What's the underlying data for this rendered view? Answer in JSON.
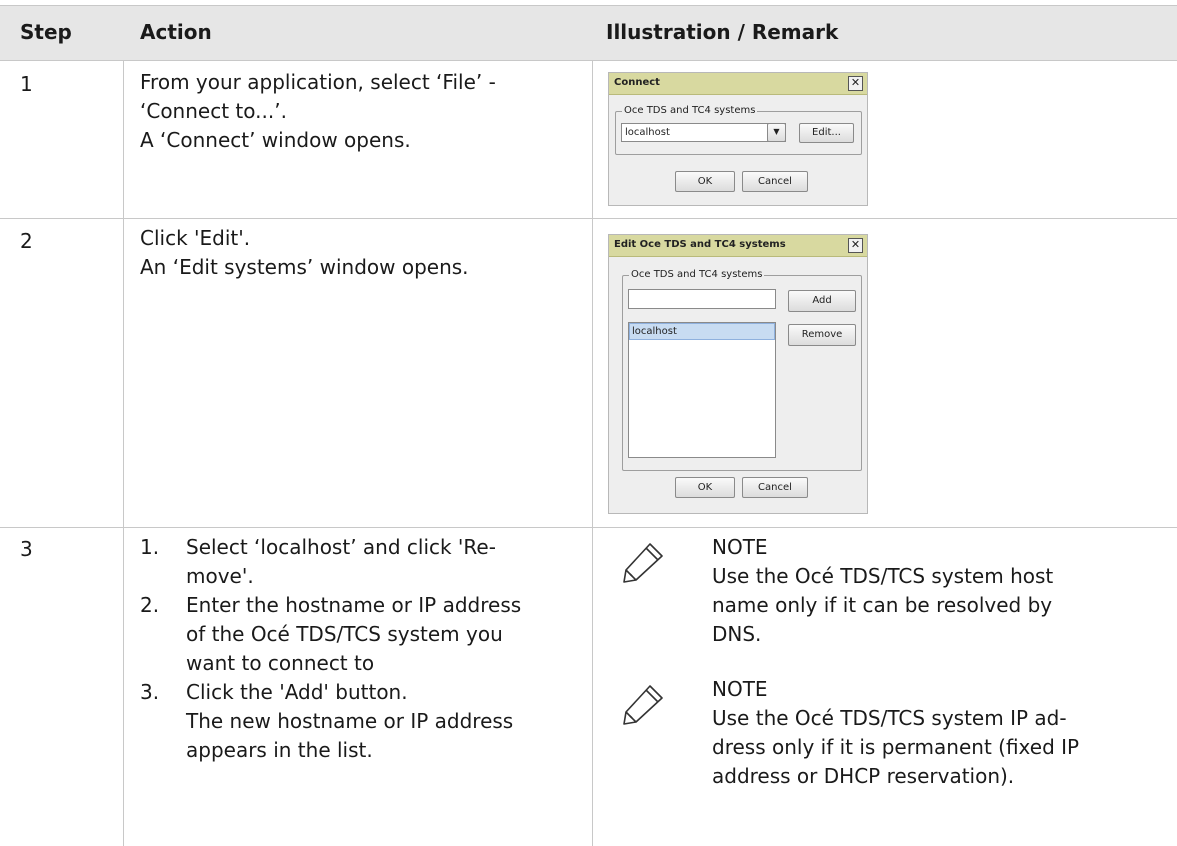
{
  "headers": {
    "step": "Step",
    "action": "Action",
    "illustration": "Illustration / Remark"
  },
  "rows": [
    {
      "step": "1",
      "action_lines": [
        "From your application, select ‘File’ -",
        "‘Connect to...’.",
        "A ‘Connect’ window opens."
      ]
    },
    {
      "step": "2",
      "action_lines": [
        "Click 'Edit'.",
        "An ‘Edit systems’ window opens."
      ]
    },
    {
      "step": "3",
      "list": [
        {
          "num": "1.",
          "lines": [
            "Select ‘localhost’ and click 'Re-",
            "move'."
          ]
        },
        {
          "num": "2.",
          "lines": [
            "Enter the hostname or IP address",
            "of the Océ TDS/TCS system you",
            "want to connect to"
          ]
        },
        {
          "num": "3.",
          "lines": [
            "Click the 'Add' button.",
            "The new hostname or IP address",
            "appears in the list."
          ]
        }
      ],
      "notes": [
        {
          "heading": "NOTE",
          "lines": [
            "Use the Océ TDS/TCS system host",
            "name only if it can be resolved by",
            "DNS."
          ]
        },
        {
          "heading": "NOTE",
          "lines": [
            "Use the Océ TDS/TCS system IP ad-",
            "dress only if it is permanent (fixed IP",
            "address or DHCP reservation)."
          ]
        }
      ]
    }
  ],
  "connect_dialog": {
    "title": "Connect",
    "group_label": "Oce TDS and TC4 systems",
    "combo_value": "localhost",
    "edit_button": "Edit...",
    "ok_button": "OK",
    "cancel_button": "Cancel"
  },
  "edit_dialog": {
    "title": "Edit Oce TDS and TC4 systems",
    "group_label": "Oce TDS and TC4 systems",
    "input_value": "",
    "add_button": "Add",
    "list_items": [
      "localhost"
    ],
    "remove_button": "Remove",
    "ok_button": "OK",
    "cancel_button": "Cancel"
  },
  "colors": {
    "header_bg": "#e6e6e6",
    "grid": "#c8c8c8",
    "titlebar": "#d8d9a0",
    "selection": "#c8dcf2"
  }
}
